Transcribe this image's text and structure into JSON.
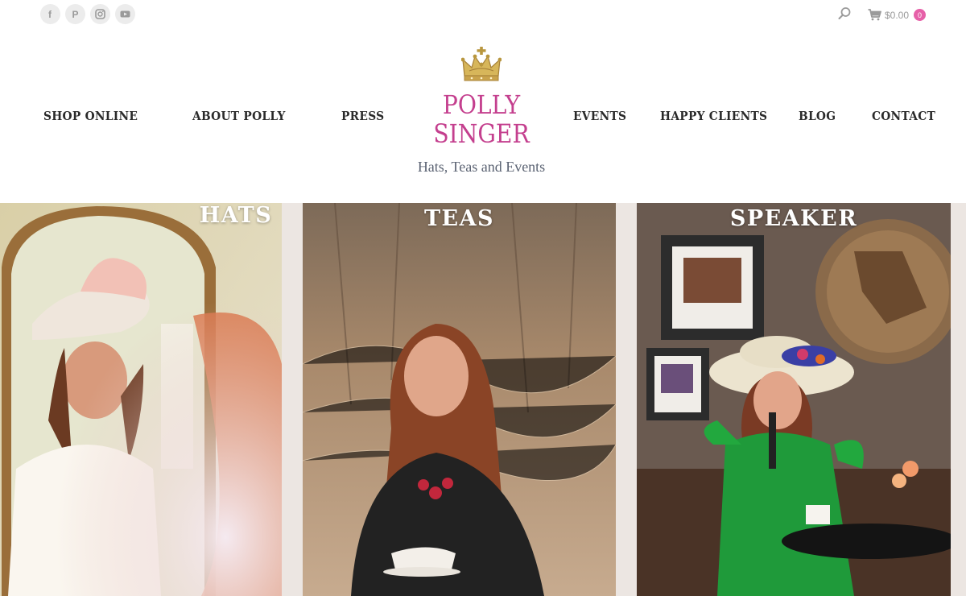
{
  "social": {
    "icons": [
      "facebook-icon",
      "pinterest-icon",
      "instagram-icon",
      "youtube-icon"
    ],
    "labels": [
      "f",
      "P",
      "",
      ""
    ]
  },
  "header": {
    "cart_total": "$0.00",
    "cart_count": "0"
  },
  "nav": {
    "left": [
      "SHOP ONLINE",
      "ABOUT POLLY",
      "PRESS"
    ],
    "right": [
      "EVENTS",
      "HAPPY CLIENTS",
      "BLOG",
      "CONTACT"
    ]
  },
  "logo": {
    "line1": "POLLY",
    "line2": "SINGER",
    "tagline": "Hats, Teas and Events"
  },
  "panels": [
    {
      "title": "HATS"
    },
    {
      "title": "TEAS"
    },
    {
      "title": "SPEAKER"
    }
  ],
  "colors": {
    "brand": "#c43f8e",
    "cart_badge": "#e660a8",
    "nav_text": "#2a2a2a",
    "tagline": "#5a6272"
  }
}
